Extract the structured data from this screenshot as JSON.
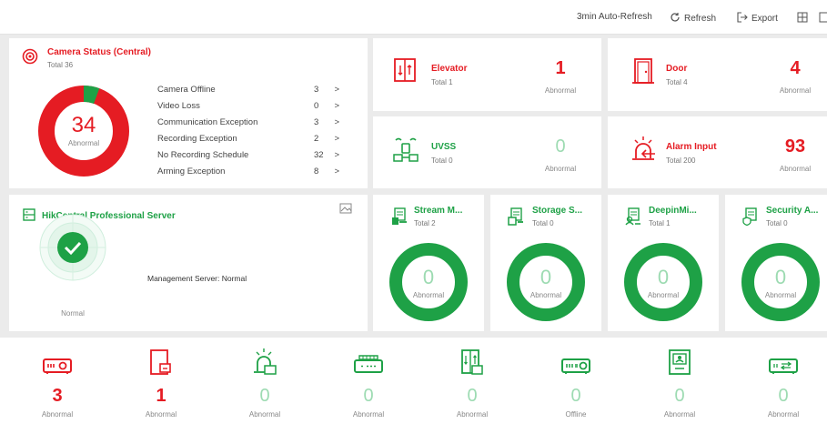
{
  "toolbar": {
    "auto_refresh": "3min Auto-Refresh",
    "refresh": "Refresh",
    "export": "Export"
  },
  "camera": {
    "title": "Camera Status (Central)",
    "total": "Total 36",
    "center_value": "34",
    "center_label": "Abnormal",
    "normal_fraction": 0.056,
    "items": [
      {
        "label": "Camera Offline",
        "value": "3"
      },
      {
        "label": "Video Loss",
        "value": "0"
      },
      {
        "label": "Communication Exception",
        "value": "3"
      },
      {
        "label": "Recording Exception",
        "value": "2"
      },
      {
        "label": "No Recording Schedule",
        "value": "32"
      },
      {
        "label": "Arming Exception",
        "value": "8"
      }
    ]
  },
  "elevator": {
    "name": "Elevator",
    "total": "Total 1",
    "value": "1",
    "label": "Abnormal"
  },
  "door": {
    "name": "Door",
    "total": "Total 4",
    "value": "4",
    "label": "Abnormal"
  },
  "uvss": {
    "name": "UVSS",
    "total": "Total 0",
    "value": "0",
    "label": "Abnormal"
  },
  "alarm": {
    "name": "Alarm Input",
    "total": "Total 200",
    "value": "93",
    "label": "Abnormal"
  },
  "server": {
    "title": "HikCentral Professional Server",
    "status": "Management Server: Normal",
    "icon_label": "Normal"
  },
  "servers": [
    {
      "name": "Stream M...",
      "total": "Total 2",
      "value": "0",
      "label": "Abnormal"
    },
    {
      "name": "Storage S...",
      "total": "Total 0",
      "value": "0",
      "label": "Abnormal"
    },
    {
      "name": "DeepinMi...",
      "total": "Total 1",
      "value": "0",
      "label": "Abnormal"
    },
    {
      "name": "Security A...",
      "total": "Total 0",
      "value": "0",
      "label": "Abnormal"
    }
  ],
  "bottom": [
    {
      "value": "3",
      "label": "Abnormal",
      "color": "#e51c23",
      "icon": "encoder-icon"
    },
    {
      "value": "1",
      "label": "Abnormal",
      "color": "#e51c23",
      "icon": "access-controller-icon"
    },
    {
      "value": "0",
      "label": "Abnormal",
      "color": "#1ea146",
      "icon": "alarm-device-icon"
    },
    {
      "value": "0",
      "label": "Abnormal",
      "color": "#1ea146",
      "icon": "security-control-panel-icon"
    },
    {
      "value": "0",
      "label": "Abnormal",
      "color": "#1ea146",
      "icon": "elevator-controller-icon"
    },
    {
      "value": "0",
      "label": "Offline",
      "color": "#1ea146",
      "icon": "decoder-icon"
    },
    {
      "value": "0",
      "label": "Abnormal",
      "color": "#1ea146",
      "icon": "video-intercom-icon"
    },
    {
      "value": "0",
      "label": "Abnormal",
      "color": "#1ea146",
      "icon": "network-switch-icon"
    }
  ]
}
